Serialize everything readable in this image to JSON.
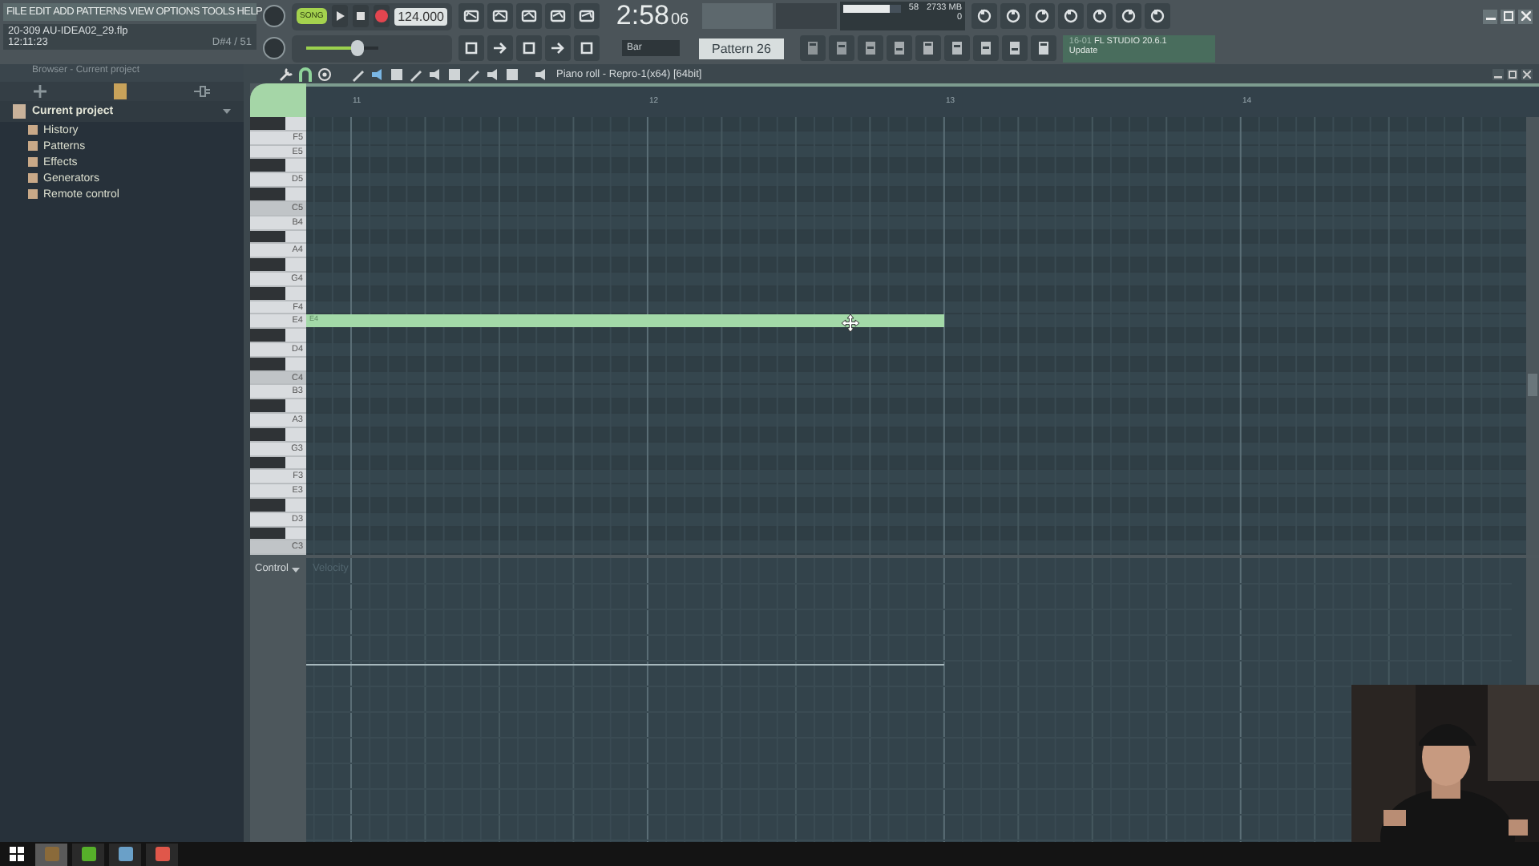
{
  "menu": [
    "FILE",
    "EDIT",
    "ADD",
    "PATTERNS",
    "VIEW",
    "OPTIONS",
    "TOOLS",
    "HELP"
  ],
  "project": {
    "file": "20-309 AU-IDEA02_29.flp",
    "time": "12:11:23",
    "note": "D#4 / 51"
  },
  "transport": {
    "mode": "SONG",
    "tempo": "124.000",
    "pitch": {
      "level": 0.7
    }
  },
  "time": {
    "value": "2:58",
    "fraction": "06"
  },
  "monitor": {
    "cpu": "58",
    "level": 0.8,
    "memory": "2733 MB",
    "polyphony": "0"
  },
  "snap": "Bar",
  "pattern": "Pattern 26",
  "hint": {
    "id": "16-01",
    "title": "FL STUDIO 20.6.1",
    "action": "Update"
  },
  "browser": {
    "title": "Browser - Current project",
    "root": {
      "label": "Current project",
      "expanded": true,
      "children": [
        {
          "label": "History"
        },
        {
          "label": "Patterns"
        },
        {
          "label": "Effects"
        },
        {
          "label": "Generators"
        },
        {
          "label": "Remote control"
        }
      ]
    }
  },
  "piano_roll": {
    "title": "Piano roll - Repro-1(x64) [64bit]",
    "bars": [
      "11",
      "12",
      "13",
      "14"
    ],
    "keys": [
      {
        "kind": "black"
      },
      {
        "kind": "white",
        "label": "F5"
      },
      {
        "kind": "white",
        "label": "E5"
      },
      {
        "kind": "black"
      },
      {
        "kind": "white",
        "label": "D5"
      },
      {
        "kind": "black"
      },
      {
        "kind": "octave",
        "label": "C5"
      },
      {
        "kind": "white",
        "label": "B4"
      },
      {
        "kind": "black"
      },
      {
        "kind": "white",
        "label": "A4"
      },
      {
        "kind": "black"
      },
      {
        "kind": "white",
        "label": "G4"
      },
      {
        "kind": "black"
      },
      {
        "kind": "white",
        "label": "F4"
      },
      {
        "kind": "white",
        "label": "E4",
        "note": {
          "label": "E4"
        }
      },
      {
        "kind": "black"
      },
      {
        "kind": "white",
        "label": "D4"
      },
      {
        "kind": "black"
      },
      {
        "kind": "octave",
        "label": "C4"
      },
      {
        "kind": "white",
        "label": "B3"
      },
      {
        "kind": "black"
      },
      {
        "kind": "white",
        "label": "A3"
      },
      {
        "kind": "black"
      },
      {
        "kind": "white",
        "label": "G3"
      },
      {
        "kind": "black"
      },
      {
        "kind": "white",
        "label": "F3"
      },
      {
        "kind": "white",
        "label": "E3"
      },
      {
        "kind": "black"
      },
      {
        "kind": "white",
        "label": "D3"
      },
      {
        "kind": "black"
      },
      {
        "kind": "octave",
        "label": "C3"
      }
    ],
    "control": {
      "label": "Control",
      "parameter": "Velocity"
    }
  },
  "taskbar": {
    "apps": [
      {
        "selected": true
      },
      {
        "selected": false
      },
      {
        "selected": false
      },
      {
        "selected": false
      }
    ]
  }
}
